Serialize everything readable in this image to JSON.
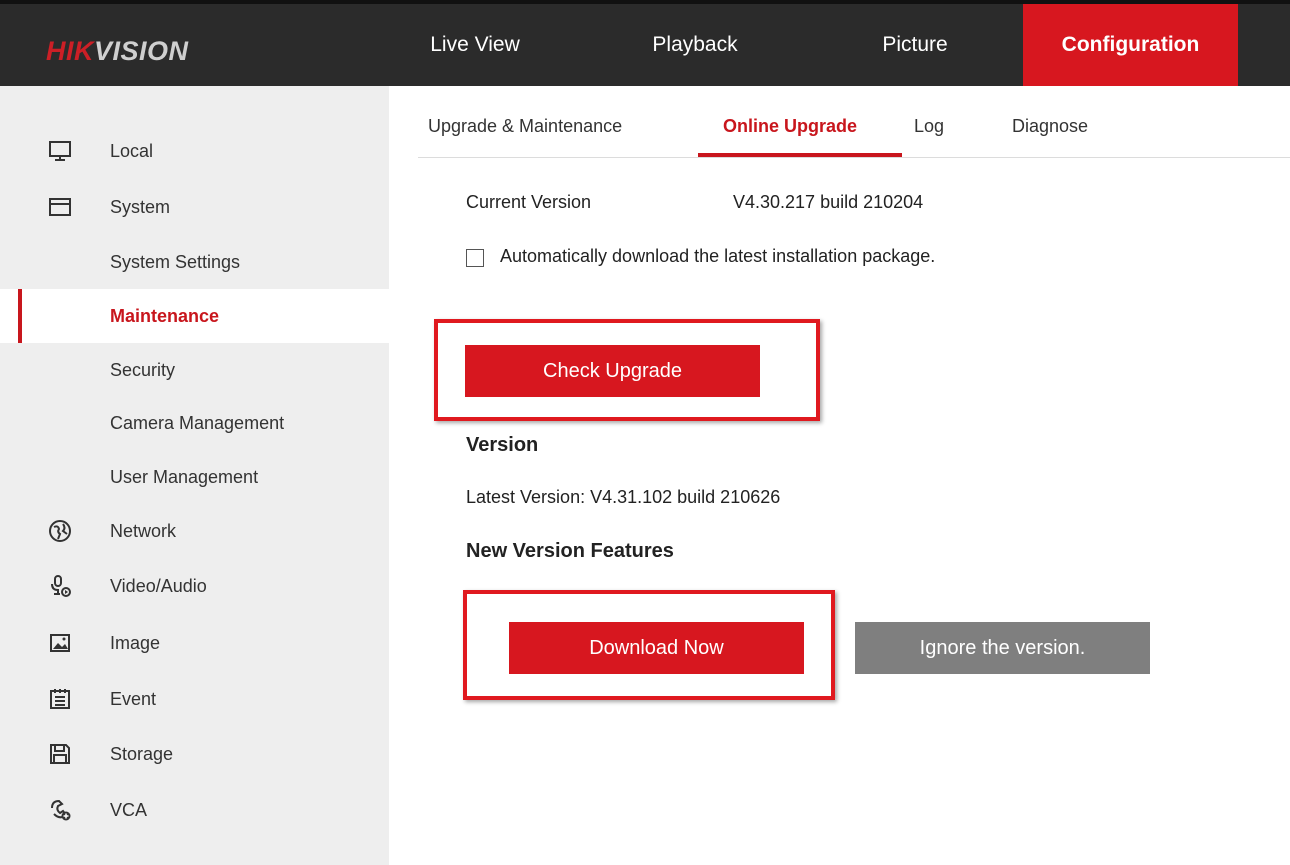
{
  "header": {
    "logo_hik": "HIK",
    "logo_rest": "VISION",
    "nav": [
      {
        "label": "Live View"
      },
      {
        "label": "Playback"
      },
      {
        "label": "Picture"
      },
      {
        "label": "Configuration"
      }
    ]
  },
  "sidebar": {
    "items": [
      {
        "label": "Local",
        "icon": "monitor-icon"
      },
      {
        "label": "System",
        "icon": "window-icon"
      },
      {
        "label": "System Settings"
      },
      {
        "label": "Maintenance"
      },
      {
        "label": "Security"
      },
      {
        "label": "Camera Management"
      },
      {
        "label": "User Management"
      },
      {
        "label": "Network",
        "icon": "globe-icon"
      },
      {
        "label": "Video/Audio",
        "icon": "microphone-icon"
      },
      {
        "label": "Image",
        "icon": "image-icon"
      },
      {
        "label": "Event",
        "icon": "calendar-icon"
      },
      {
        "label": "Storage",
        "icon": "floppy-disk-icon"
      },
      {
        "label": "VCA",
        "icon": "vca-icon"
      }
    ]
  },
  "subtabs": [
    {
      "label": "Upgrade & Maintenance"
    },
    {
      "label": "Online Upgrade"
    },
    {
      "label": "Log"
    },
    {
      "label": "Diagnose"
    }
  ],
  "main": {
    "current_version_label": "Current Version",
    "current_version_value": "V4.30.217 build 210204",
    "auto_download_label": "Automatically download the latest installation package.",
    "check_upgrade_button": "Check Upgrade",
    "version_heading": "Version",
    "latest_version": "Latest Version: V4.31.102 build 210626",
    "features_heading": "New Version Features",
    "download_now_button": "Download Now",
    "ignore_button": "Ignore the version."
  },
  "colors": {
    "accent": "#d7171f",
    "header_bg": "#2b2b2b",
    "sidebar_bg": "#eeeeee",
    "ignore_button": "#7f7f7f"
  }
}
